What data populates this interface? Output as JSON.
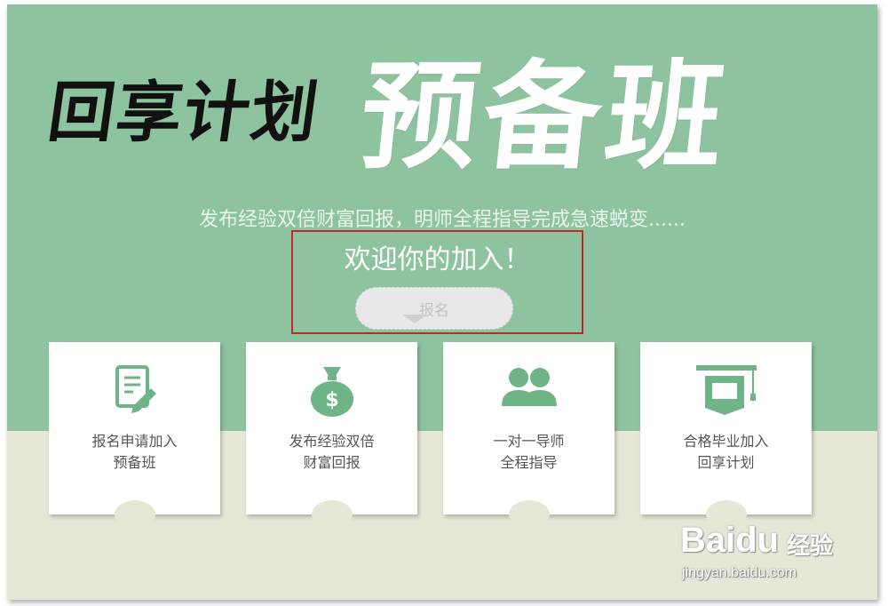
{
  "banner": {
    "title_left": "回享计划",
    "title_right": "预备班",
    "subtitle": "发布经验双倍财富回报，明师全程指导完成急速蜕变......",
    "welcome": "欢迎你的加入！",
    "signup_label": "报名"
  },
  "cards": [
    {
      "icon": "application-form-icon",
      "line1": "报名申请加入",
      "line2": "预备班"
    },
    {
      "icon": "money-bag-icon",
      "line1": "发布经验双倍",
      "line2": "财富回报"
    },
    {
      "icon": "mentor-pair-icon",
      "line1": "一对一导师",
      "line2": "全程指导"
    },
    {
      "icon": "graduation-cap-icon",
      "line1": "合格毕业加入",
      "line2": "回享计划"
    }
  ],
  "watermark": {
    "logo": "Baidu",
    "brand": "经验",
    "url": "jingyan.baidu.com"
  },
  "colors": {
    "banner_green": "#8ec39f",
    "icon_green": "#6fb486",
    "highlight_red": "#c0282a",
    "floor_beige": "#e7e7d8"
  }
}
